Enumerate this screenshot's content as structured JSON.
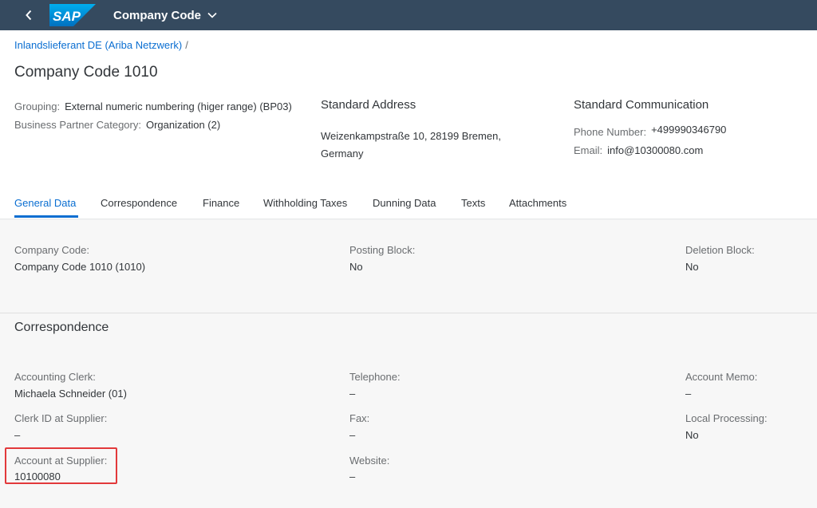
{
  "shell": {
    "logo_text": "SAP",
    "app_title": "Company Code",
    "icons": {
      "back": "chevron-left-icon",
      "title_dropdown": "chevron-down-icon"
    }
  },
  "header": {
    "breadcrumb": {
      "link": "Inlandslieferant DE (Ariba Netzwerk)",
      "separator": "/"
    },
    "title": "Company Code 1010",
    "attributes": [
      {
        "label": "Grouping:",
        "value": "External numeric numbering (higer range) (BP03)"
      },
      {
        "label": "Business Partner Category:",
        "value": "Organization (2)"
      }
    ],
    "address": {
      "title": "Standard Address",
      "line1": "Weizenkampstraße 10, 28199 Bremen,",
      "line2": "Germany"
    },
    "communication": {
      "title": "Standard Communication",
      "phone_label": "Phone Number:",
      "phone_value": "+499990346790",
      "email_label": "Email:",
      "email_value": "info@10300080.com"
    }
  },
  "tabs": [
    {
      "label": "General Data",
      "active": true
    },
    {
      "label": "Correspondence",
      "active": false
    },
    {
      "label": "Finance",
      "active": false
    },
    {
      "label": "Withholding Taxes",
      "active": false
    },
    {
      "label": "Dunning Data",
      "active": false
    },
    {
      "label": "Texts",
      "active": false
    },
    {
      "label": "Attachments",
      "active": false
    }
  ],
  "general": {
    "company_code": {
      "label": "Company Code:",
      "value": "Company Code 1010 (1010)"
    },
    "posting_block": {
      "label": "Posting Block:",
      "value": "No"
    },
    "deletion_block": {
      "label": "Deletion Block:",
      "value": "No"
    }
  },
  "correspondence": {
    "title": "Correspondence",
    "accounting_clerk": {
      "label": "Accounting Clerk:",
      "value": "Michaela Schneider (01)"
    },
    "telephone": {
      "label": "Telephone:",
      "value": "–"
    },
    "account_memo": {
      "label": "Account Memo:",
      "value": "–"
    },
    "clerk_id": {
      "label": "Clerk ID at Supplier:",
      "value": "–"
    },
    "fax": {
      "label": "Fax:",
      "value": "–"
    },
    "local_processing": {
      "label": "Local Processing:",
      "value": "No"
    },
    "account_at_supplier": {
      "label": "Account at Supplier:",
      "value": "10100080"
    },
    "website": {
      "label": "Website:",
      "value": "–"
    }
  },
  "colors": {
    "shell_bg": "#354a5f",
    "accent": "#0a6ed1",
    "highlight": "#e2393b"
  }
}
